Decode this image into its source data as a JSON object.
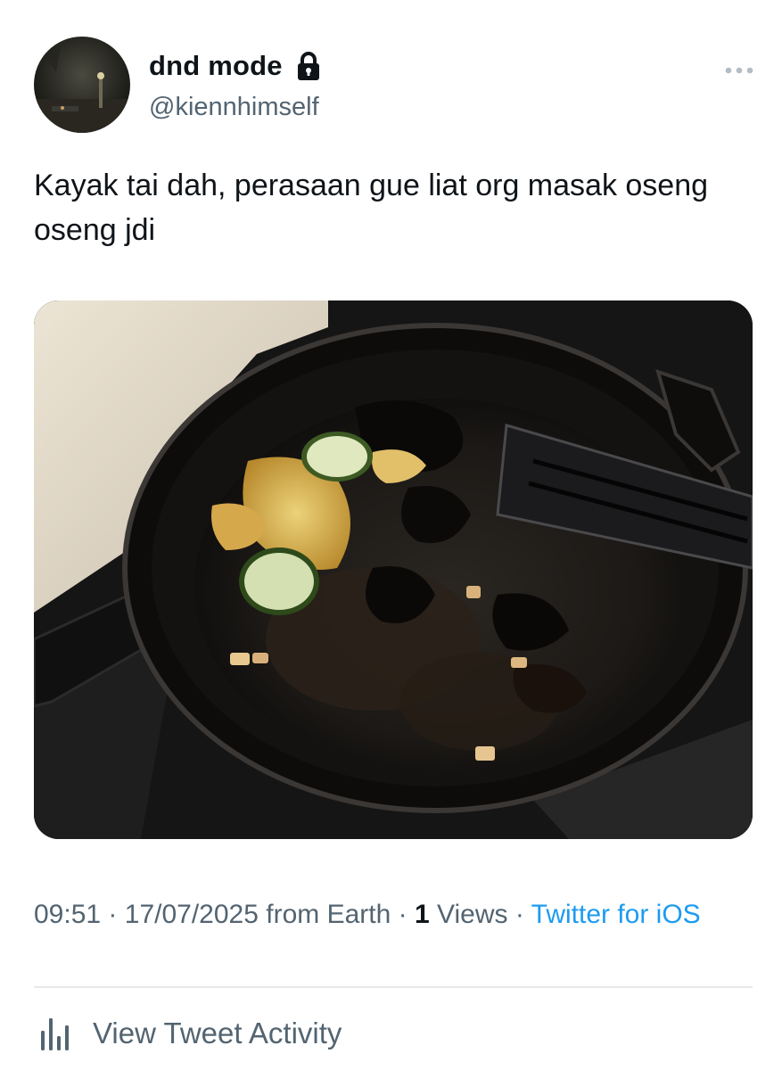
{
  "author": {
    "display_name": "dnd mode",
    "handle": "@kiennhimself",
    "protected_icon": "lock-icon",
    "avatar": "avatar-photo"
  },
  "tweet": {
    "text": "Kayak tai dah, perasaan gue liat org masak oseng oseng jdi",
    "media": "photo-burnt-skillet"
  },
  "meta": {
    "time": "09:51",
    "separator": "·",
    "date": "17/07/2025",
    "location": "from Earth",
    "views_count": "1",
    "views_label": "Views",
    "source": "Twitter for iOS"
  },
  "actions": {
    "view_activity": "View Tweet Activity",
    "activity_icon": "analytics-icon",
    "more_icon": "more-icon"
  },
  "colors": {
    "text": "#0f1419",
    "secondary": "#536471",
    "link": "#1d9bf0"
  }
}
